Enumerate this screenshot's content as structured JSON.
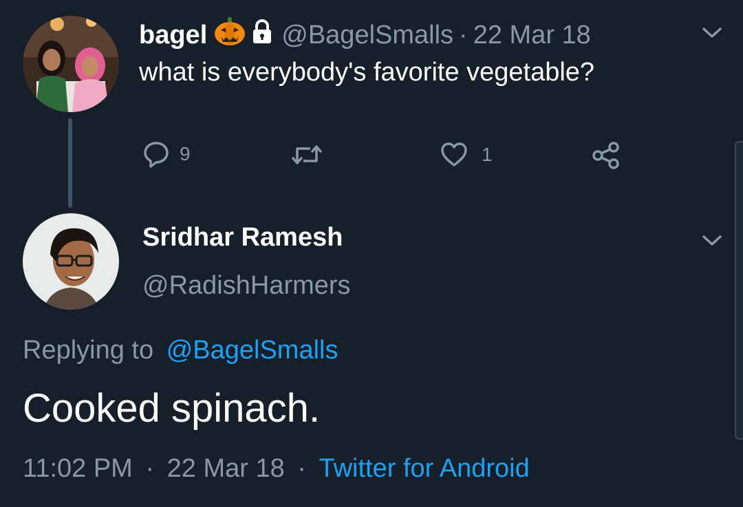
{
  "original_tweet": {
    "display_name": "bagel",
    "badges": [
      "jack-o-lantern-emoji",
      "lock-icon"
    ],
    "handle": "@BagelSmalls",
    "separator": "·",
    "date": "22 Mar 18",
    "text": "what is everybody's favorite vegetable?",
    "actions": {
      "reply_count": "9",
      "retweet_count": "",
      "like_count": "1"
    }
  },
  "reply_tweet": {
    "display_name": "Sridhar Ramesh",
    "handle": "@RadishHarmers",
    "replying_prefix": "Replying to",
    "replying_handle": "@BagelSmalls",
    "text": "Cooked spinach.",
    "time": "11:02 PM",
    "separator": "·",
    "date": "22 Mar 18",
    "source": "Twitter for Android"
  },
  "colors": {
    "background": "#161f2a",
    "muted_text": "#8899a6",
    "link": "#1da1f2",
    "thread_line": "#3d5466"
  }
}
